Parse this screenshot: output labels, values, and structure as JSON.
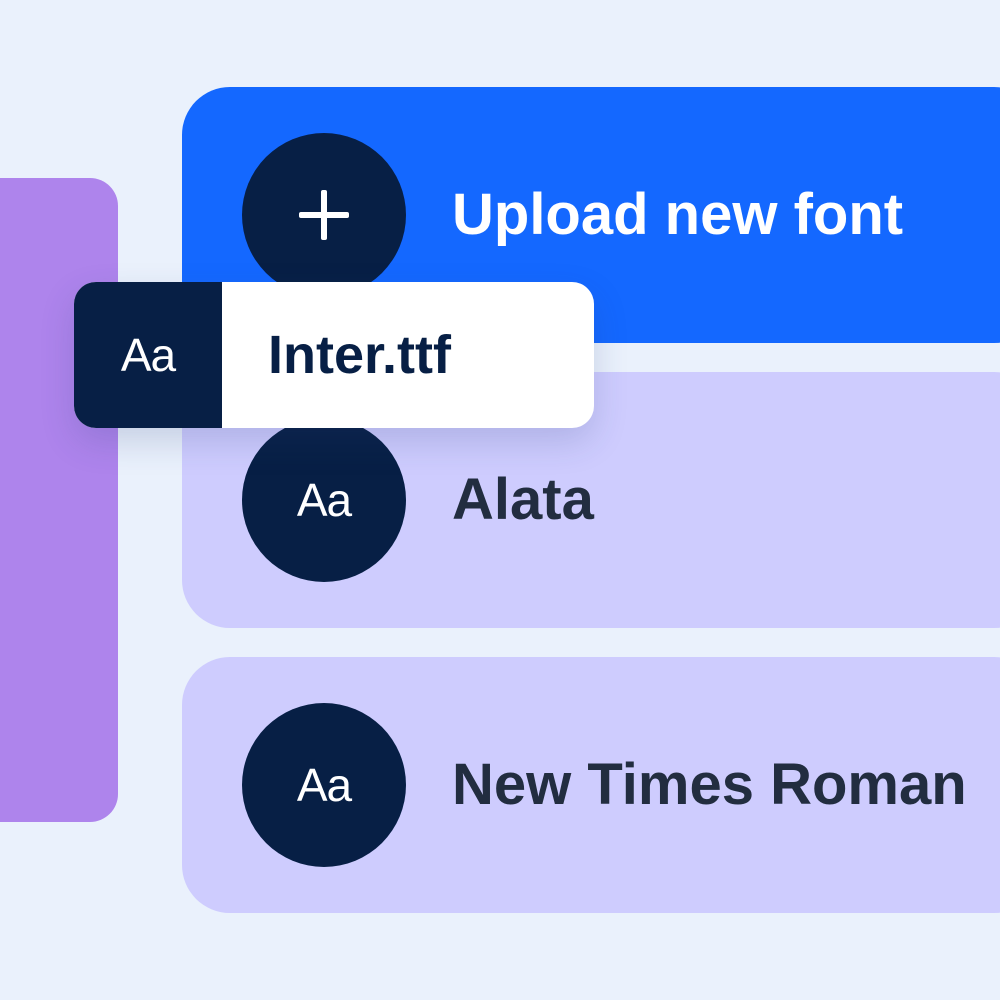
{
  "upload_card": {
    "title": "Upload new font",
    "icon": "plus-icon"
  },
  "uploaded_file": {
    "icon_label": "Aa",
    "filename": "Inter.ttf"
  },
  "font_list": [
    {
      "icon_label": "Aa",
      "name": "Alata"
    },
    {
      "icon_label": "Aa",
      "name": "New Times Roman"
    }
  ],
  "colors": {
    "background": "#EAF1FC",
    "side_panel": "#AE84EC",
    "upload_card": "#1468FF",
    "font_card": "#CECCFE",
    "icon_circle": "#071F45",
    "text_dark": "#222D40"
  }
}
